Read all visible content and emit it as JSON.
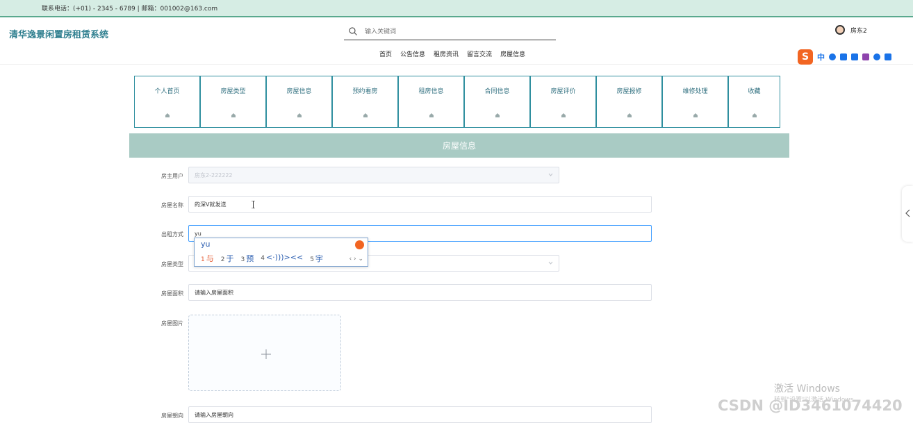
{
  "topbar": {
    "contact": "联系电话：(+01) - 2345 - 6789 | 邮箱：001002@163.com"
  },
  "header": {
    "brand": "清华逸景闲置房租赁系统",
    "search_placeholder": "输入关键词",
    "nav": [
      "首页",
      "公告信息",
      "租房资讯",
      "留言交流",
      "房屋信息"
    ],
    "user_name": "房东2"
  },
  "ime_toolbar": {
    "logo": "S",
    "mode": "中"
  },
  "menu": [
    "个人首页",
    "房屋类型",
    "房屋信息",
    "预约看房",
    "租房信息",
    "合同信息",
    "房屋评价",
    "房屋报修",
    "维修处理",
    "收藏"
  ],
  "section_title": "房屋信息",
  "form": {
    "owner": {
      "label": "房主用户",
      "value": "房东2-222222"
    },
    "name": {
      "label": "房屋名称",
      "value": "的深V就发送"
    },
    "rent_mode": {
      "label": "出租方式",
      "value": "yu"
    },
    "type": {
      "label": "房屋类型"
    },
    "area": {
      "label": "房屋面积",
      "placeholder": "请输入房屋面积"
    },
    "photo": {
      "label": "房屋图片"
    },
    "orientation": {
      "label": "房屋朝向",
      "placeholder": "请输入房屋朝向"
    }
  },
  "ime_popup": {
    "composition": "yu",
    "candidates": [
      {
        "n": "1",
        "w": "与"
      },
      {
        "n": "2",
        "w": "于"
      },
      {
        "n": "3",
        "w": "预"
      },
      {
        "n": "4",
        "w": "<·)))><<"
      },
      {
        "n": "5",
        "w": "宇"
      }
    ],
    "pager": "‹ › ⌄"
  },
  "watermark": {
    "line1": "激活 Windows",
    "line2": "转到\"设置\"以激活 Windows。",
    "csdn": "CSDN @ID3461074420"
  },
  "colors": {
    "accent": "#2f8f9f",
    "section": "#a9cbc4",
    "topbar": "#d6ede4"
  }
}
